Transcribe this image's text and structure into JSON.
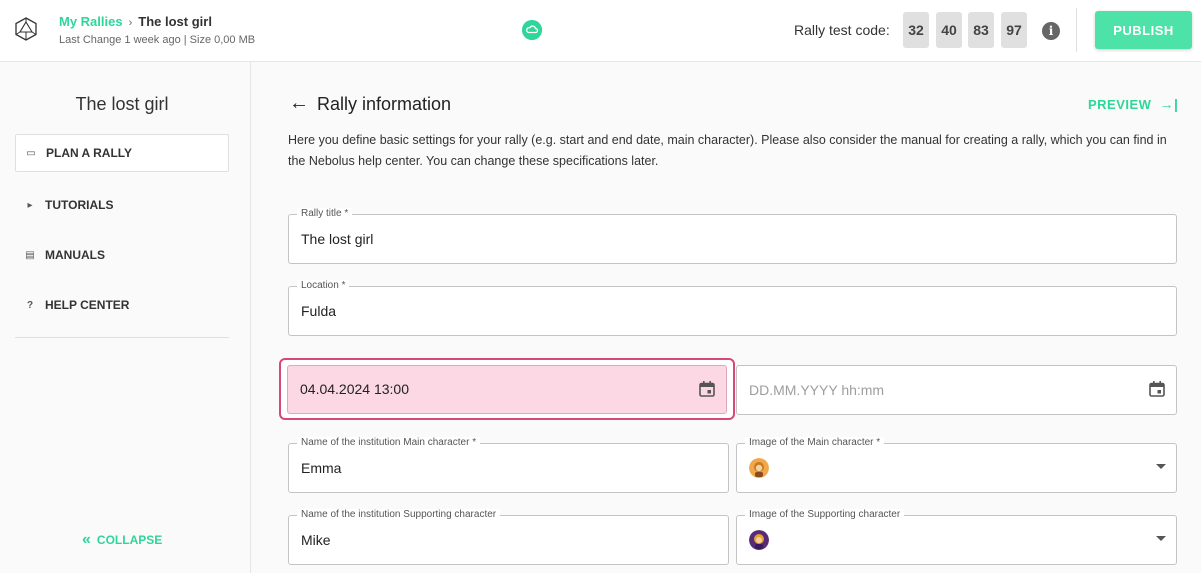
{
  "header": {
    "breadcrumb_link": "My Rallies",
    "breadcrumb_separator": "›",
    "breadcrumb_current": "The lost girl",
    "meta": "Last Change 1 week ago | Size 0,00 MB",
    "test_code_label": "Rally test code:",
    "test_code_digits": [
      "32",
      "40",
      "83",
      "97"
    ],
    "info_glyph": "i",
    "publish_label": "PUBLISH"
  },
  "sidebar": {
    "title": "The lost girl",
    "items": [
      {
        "label": "PLAN A RALLY",
        "icon": "gamepad-icon",
        "glyph": "▭"
      },
      {
        "label": "TUTORIALS",
        "icon": "play-icon",
        "glyph": "▸"
      },
      {
        "label": "MANUALS",
        "icon": "document-icon",
        "glyph": "▤"
      },
      {
        "label": "HELP CENTER",
        "icon": "question-icon",
        "glyph": "?"
      }
    ],
    "collapse_label": "COLLAPSE",
    "collapse_glyph": "«"
  },
  "main": {
    "back_glyph": "←",
    "heading": "Rally information",
    "preview_label": "PREVIEW",
    "preview_glyph": "→|",
    "description": "Here you define basic settings for your rally (e.g. start and end date, main character). Please also consider the manual for creating a rally, which you can find in the Nebolus help center. You can change these specifications later.",
    "fields": {
      "rally_title": {
        "label": "Rally title *",
        "value": "The lost girl"
      },
      "location": {
        "label": "Location *",
        "value": "Fulda"
      },
      "start_date": {
        "value": "04.04.2024 13:00"
      },
      "end_date": {
        "placeholder": "DD.MM.YYYY hh:mm"
      },
      "main_character_name": {
        "label": "Name of the institution Main character *",
        "value": "Emma"
      },
      "main_character_image": {
        "label": "Image of the Main character *"
      },
      "supporting_character_name": {
        "label": "Name of the institution Supporting character",
        "value": "Mike"
      },
      "supporting_character_image": {
        "label": "Image of the Supporting character"
      }
    }
  },
  "colors": {
    "accent": "#2ed69a",
    "publish": "#4de3a8",
    "highlight_border": "#d6477a",
    "highlight_fill": "#fcd8e4"
  }
}
